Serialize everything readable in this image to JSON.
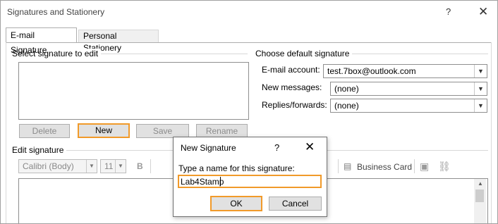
{
  "window": {
    "title": "Signatures and Stationery",
    "help_glyph": "?",
    "close_glyph": "✕"
  },
  "tabs": [
    {
      "label": "E-mail Signature"
    },
    {
      "label": "Personal Stationery"
    }
  ],
  "select_signature": {
    "label": "Select signature to edit",
    "buttons": {
      "delete": "Delete",
      "new": "New",
      "save": "Save",
      "rename": "Rename"
    }
  },
  "default_signature": {
    "label": "Choose default signature",
    "email_account_label": "E-mail account:",
    "email_account_value": "test.7box@outlook.com",
    "new_messages_label": "New messages:",
    "new_messages_value": "(none)",
    "replies_label": "Replies/forwards:",
    "replies_value": "(none)"
  },
  "edit_signature": {
    "label": "Edit signature",
    "font_value": "Calibri (Body)",
    "size_value": "11",
    "bold_glyph": "B",
    "business_card_label": "Business Card"
  },
  "dialog": {
    "title": "New Signature",
    "help_glyph": "?",
    "close_glyph": "✕",
    "prompt": "Type a name for this signature:",
    "input_value": "Lab4Stamp",
    "ok_label": "OK",
    "cancel_label": "Cancel"
  },
  "colors": {
    "focus_accent": "#f19a2a",
    "button_face": "#e1e1e1",
    "disabled_text": "#8b8b8b"
  }
}
